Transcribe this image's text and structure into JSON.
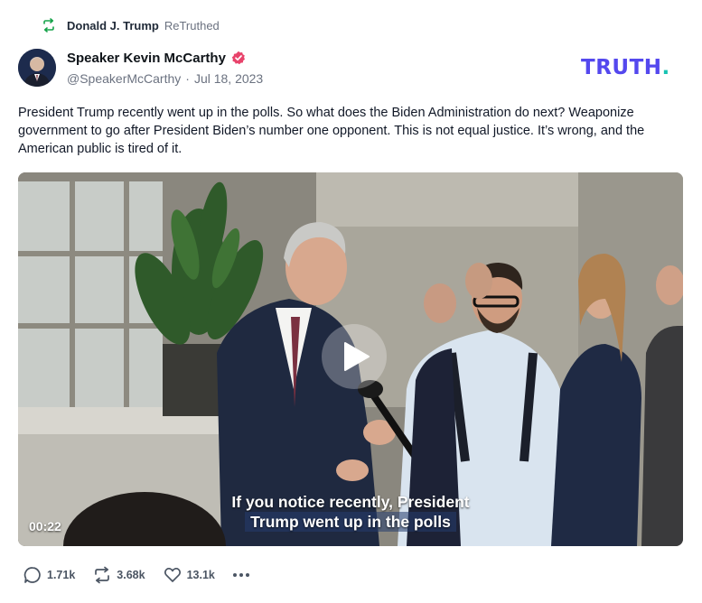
{
  "retruth": {
    "user": "Donald J. Trump",
    "label": "ReTruthed",
    "icon": "retruth-icon"
  },
  "author": {
    "name": "Speaker Kevin McCarthy",
    "handle": "@SpeakerMcCarthy",
    "separator": "·",
    "date": "Jul 18, 2023",
    "verified_icon": "verified-badge-icon"
  },
  "brand": {
    "logo_text": "TRUTH",
    "logo_dot": ".",
    "primary_color": "#5448ee",
    "dot_color": "#17c3b2"
  },
  "post": {
    "text": "President Trump recently went up in the polls. So what does the Biden Administration do next? Weaponize government to go after President Biden’s number one opponent. This is not equal justice. It’s wrong, and the American public is tired of it."
  },
  "video": {
    "caption_line1": "If you notice recently, President",
    "caption_line2": "Trump went up in the polls",
    "duration": "00:22",
    "play_icon": "play-icon"
  },
  "actions": {
    "replies": "1.71k",
    "retruths": "3.68k",
    "likes": "13.1k",
    "reply_icon": "reply-icon",
    "retruth_icon": "retruth-icon",
    "like_icon": "heart-icon",
    "more_icon": "more-icon"
  }
}
